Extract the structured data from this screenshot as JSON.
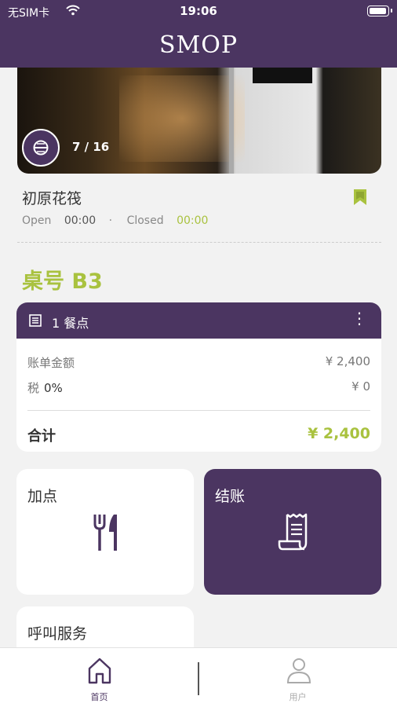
{
  "status_bar": {
    "carrier": "无SIM卡",
    "time": "19:06",
    "battery_level": 1.0
  },
  "header": {
    "logo_text": "SMOP"
  },
  "hero": {
    "counter": "7 / 16"
  },
  "shop": {
    "name": "初原花筏",
    "open_label": "Open",
    "open_time": "00:00",
    "separator": "·",
    "closed_label": "Closed",
    "closed_time": "00:00"
  },
  "table": {
    "number_label": "桌号 B3"
  },
  "bill": {
    "header_title": "1 餐点",
    "subtotal_label": "账单金额",
    "subtotal_value": "¥ 2,400",
    "tax_label": "税",
    "tax_rate": "0%",
    "tax_value": "¥ 0",
    "total_label": "合计",
    "total_value": "¥ 2,400"
  },
  "actions": {
    "add_label": "加点",
    "checkout_label": "结账",
    "call_service_label": "呼叫服务"
  },
  "tab_bar": {
    "home_label": "首页",
    "user_label": "用户"
  },
  "colors": {
    "brand_purple": "#4b3561",
    "accent_green": "#a9c23f"
  },
  "icons": [
    "wifi-icon",
    "battery-icon",
    "metro-icon",
    "bookmark-icon",
    "document-icon",
    "more-icon",
    "fork-knife-icon",
    "receipt-icon",
    "home-icon",
    "user-icon"
  ]
}
